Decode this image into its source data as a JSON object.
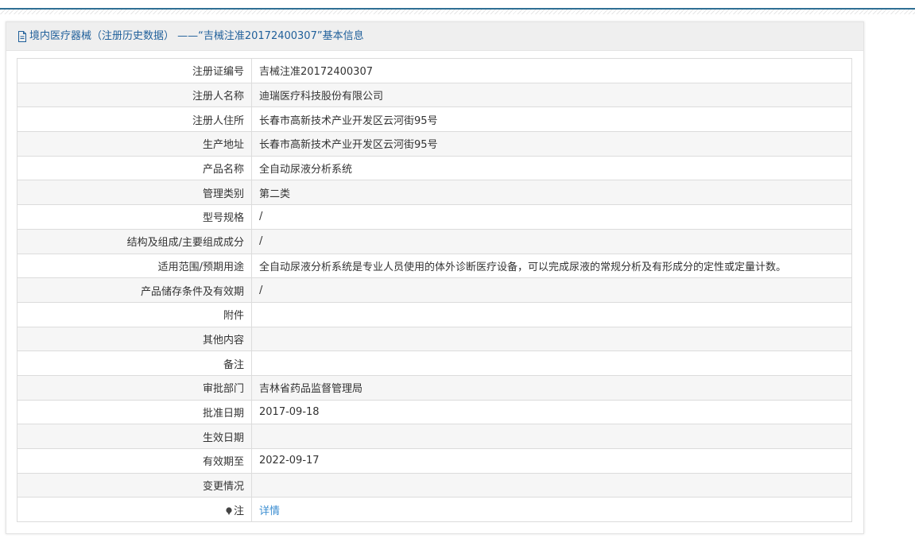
{
  "panel": {
    "title": "境内医疗器械（注册历史数据） ——“吉械注准20172400307”基本信息",
    "title_icon": "document-icon"
  },
  "rows": [
    {
      "label": "注册证编号",
      "value": "吉械注准20172400307"
    },
    {
      "label": "注册人名称",
      "value": "迪瑞医疗科技股份有限公司"
    },
    {
      "label": "注册人住所",
      "value": "长春市高新技术产业开发区云河街95号"
    },
    {
      "label": "生产地址",
      "value": "长春市高新技术产业开发区云河街95号"
    },
    {
      "label": "产品名称",
      "value": "全自动尿液分析系统"
    },
    {
      "label": "管理类别",
      "value": "第二类"
    },
    {
      "label": "型号规格",
      "value": "/"
    },
    {
      "label": "结构及组成/主要组成成分",
      "value": "/"
    },
    {
      "label": "适用范围/预期用途",
      "value": "全自动尿液分析系统是专业人员使用的体外诊断医疗设备，可以完成尿液的常规分析及有形成分的定性或定量计数。"
    },
    {
      "label": "产品储存条件及有效期",
      "value": "/"
    },
    {
      "label": "附件",
      "value": ""
    },
    {
      "label": "其他内容",
      "value": ""
    },
    {
      "label": "备注",
      "value": ""
    },
    {
      "label": "审批部门",
      "value": "吉林省药品监督管理局"
    },
    {
      "label": "批准日期",
      "value": "2017-09-18"
    },
    {
      "label": "生效日期",
      "value": ""
    },
    {
      "label": "有效期至",
      "value": "2022-09-17"
    },
    {
      "label": "变更情况",
      "value": ""
    }
  ],
  "note_row": {
    "label": "注",
    "link": "详情",
    "icon": "pin-icon"
  },
  "colors": {
    "header_text": "#1f5f9a",
    "link": "#3b8ed1",
    "top_rule": "#2f6f94"
  }
}
